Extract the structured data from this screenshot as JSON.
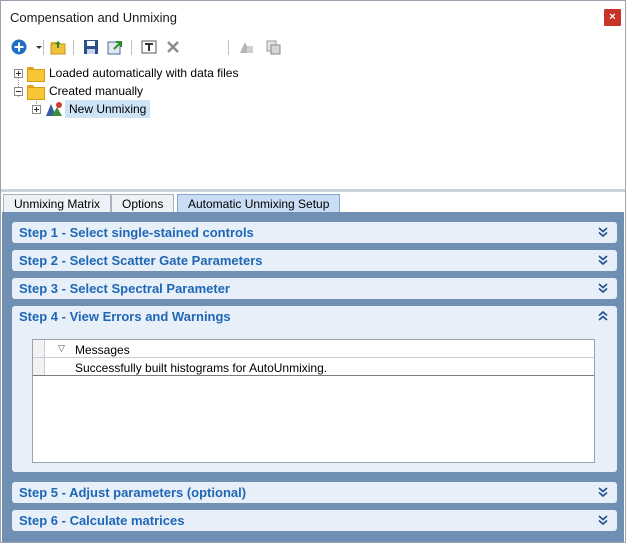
{
  "window": {
    "title": "Compensation and Unmixing",
    "close_label": "×"
  },
  "toolbar": {
    "buttons": [
      {
        "name": "add-icon",
        "icon": "plus-circle"
      },
      {
        "name": "open-icon",
        "icon": "folder-open"
      },
      {
        "name": "save-icon",
        "icon": "floppy-disk"
      },
      {
        "name": "export-icon",
        "icon": "export"
      },
      {
        "name": "rename-icon",
        "icon": "text-field"
      },
      {
        "name": "delete-icon",
        "icon": "x-mark"
      },
      {
        "name": "apply-icon",
        "icon": "apply-matrix"
      },
      {
        "name": "copy-icon",
        "icon": "copy-matrix"
      }
    ]
  },
  "tree": {
    "items": [
      {
        "label": "Loaded automatically with data files"
      },
      {
        "label": "Created manually"
      },
      {
        "label": "New Unmixing"
      }
    ]
  },
  "tabs": [
    {
      "label": "Unmixing Matrix"
    },
    {
      "label": "Options"
    },
    {
      "label": "Automatic Unmixing Setup",
      "active": true
    }
  ],
  "steps": [
    {
      "title": "Step 1 - Select single-stained controls",
      "expanded": false
    },
    {
      "title": "Step 2 - Select Scatter Gate Parameters",
      "expanded": false
    },
    {
      "title": "Step 3 - Select Spectral Parameter",
      "expanded": false
    },
    {
      "title": "Step 4 - View Errors and Warnings",
      "expanded": true
    },
    {
      "title": "Step 5 - Adjust parameters (optional)",
      "expanded": false
    },
    {
      "title": "Step 6 - Calculate matrices",
      "expanded": false
    }
  ],
  "messages": {
    "column_header": "Messages",
    "rows": [
      "Successfully built histograms for AutoUnmixing."
    ]
  },
  "colors": {
    "panel_bg": "#6f8fb3",
    "step_bg": "#e7eff8",
    "step_text": "#1f67b6",
    "close_btn": "#c7352a"
  }
}
